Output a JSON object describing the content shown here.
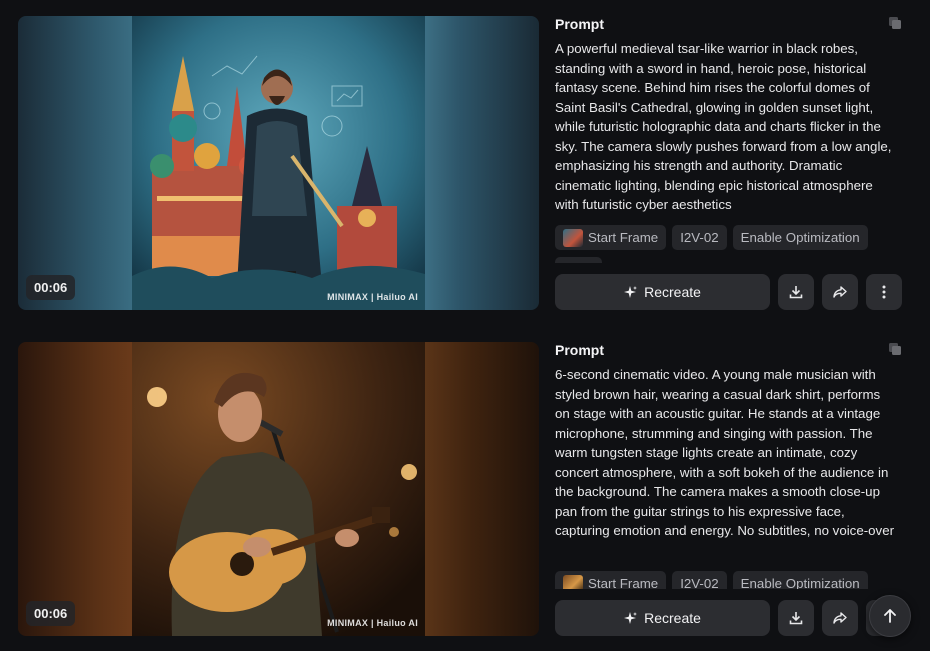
{
  "colors": {
    "background": "#0f1013",
    "surface": "#2c2d31",
    "tag_bg": "#25262a",
    "text": "#e8e8ea",
    "muted": "#b9bac0"
  },
  "cards": [
    {
      "duration": "00:06",
      "watermark": "MINIMAX | Hailuo AI",
      "prompt_title": "Prompt",
      "prompt_text": "A powerful medieval tsar-like warrior in black robes, standing with a sword in hand, heroic pose, historical fantasy scene. Behind him rises the colorful domes of Saint Basil's Cathedral, glowing in golden sunset light, while futuristic holographic data and charts flicker in the sky. The camera slowly pushes forward from a low angle, emphasizing his strength and authority. Dramatic cinematic lighting, blending epic historical atmosphere with futuristic cyber aesthetics",
      "tags": [
        "Start Frame",
        "I2V-02",
        "Enable Optimization"
      ],
      "recreate_label": "Recreate"
    },
    {
      "duration": "00:06",
      "watermark": "MINIMAX | Hailuo AI",
      "prompt_title": "Prompt",
      "prompt_text": "6-second cinematic video. A young male musician with styled brown hair, wearing a casual dark shirt, performs on stage with an acoustic guitar. He stands at a vintage microphone, strumming and singing with passion. The warm tungsten stage lights create an intimate, cozy concert atmosphere, with a soft bokeh of the audience in the background. The camera makes a smooth close-up pan from the guitar strings to his expressive face, capturing emotion and energy. No subtitles, no voice-over",
      "tags": [
        "Start Frame",
        "I2V-02",
        "Enable Optimization"
      ],
      "recreate_label": "Recreate"
    }
  ],
  "icons": [
    "copy-icon",
    "sparkle-icon",
    "download-icon",
    "share-icon",
    "more-vertical-icon",
    "arrow-up-icon"
  ]
}
